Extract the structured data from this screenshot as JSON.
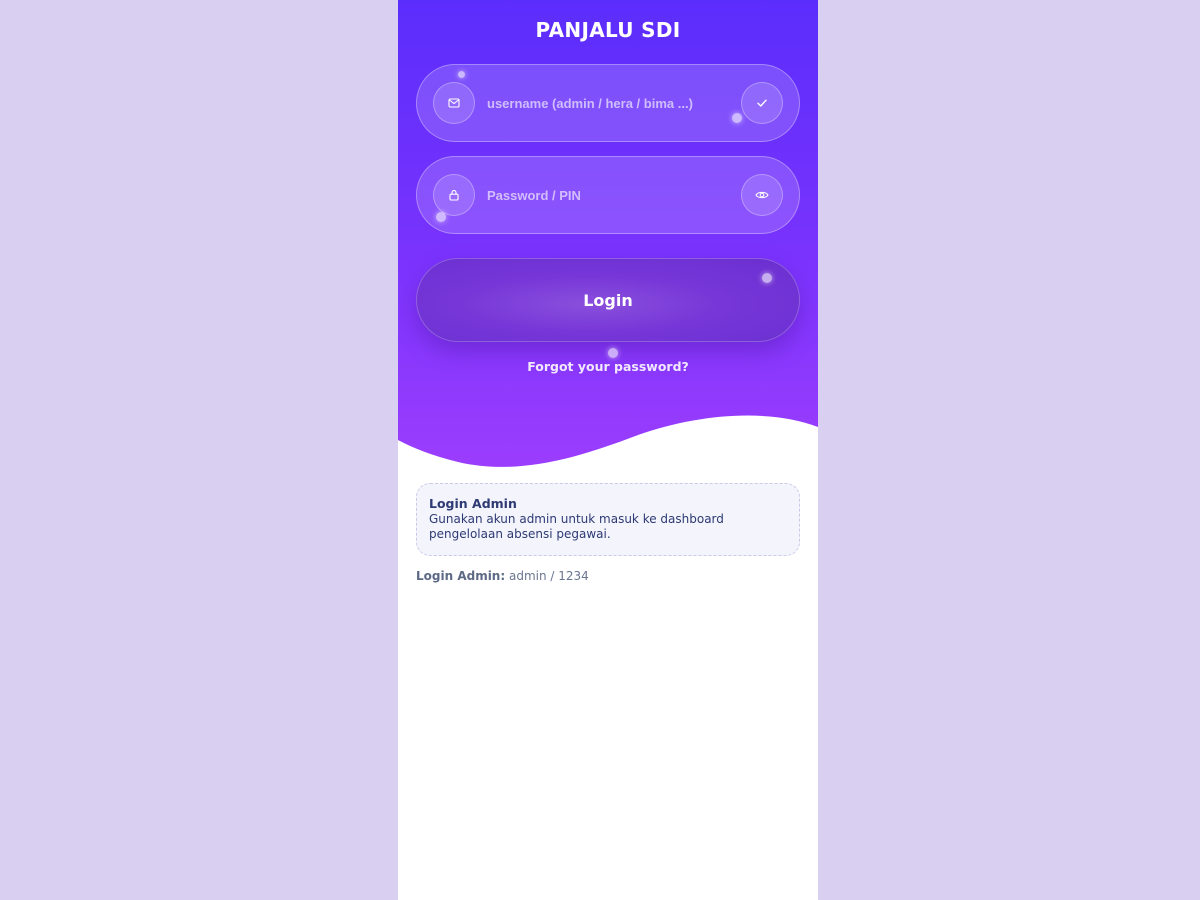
{
  "app": {
    "title": "PANJALU SDI"
  },
  "form": {
    "username_placeholder": "username (admin / hera / bima ...)",
    "username_value": "",
    "password_placeholder": "Password / PIN",
    "password_value": "",
    "login_label": "Login",
    "forgot_label": "Forgot your password?"
  },
  "icons": {
    "username_lead": "mail-icon",
    "username_trail": "check-icon",
    "password_lead": "lock-icon",
    "password_trail": "eye-icon"
  },
  "info_box": {
    "title": "Login Admin",
    "body": "Gunakan akun admin untuk masuk ke dashboard pengelolaan absensi pegawai."
  },
  "hint": {
    "label": "Login Admin:",
    "value": "admin / 1234"
  },
  "colors": {
    "page_bg": "#d9cff1",
    "gradient_top": "#5b2dfc",
    "gradient_bottom": "#9b3dfd",
    "button": "#7636d8",
    "info_text": "#2d3a73"
  }
}
